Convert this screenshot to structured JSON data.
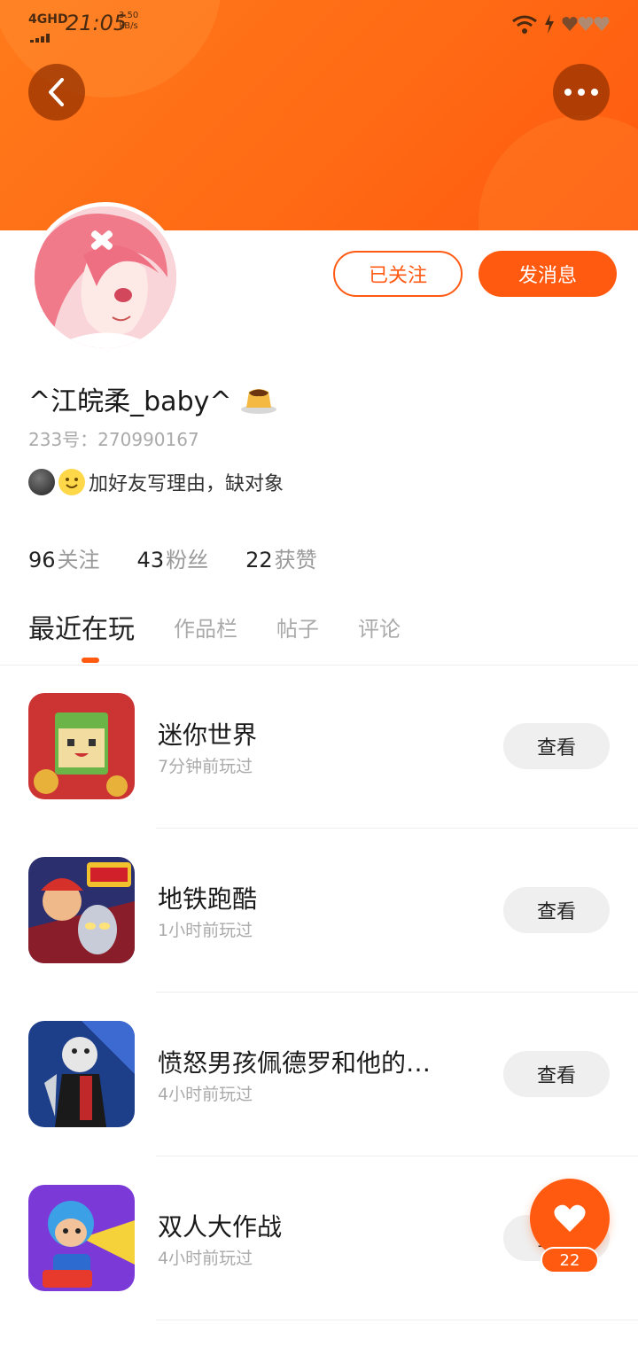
{
  "status_bar": {
    "network": "4GHD",
    "time": "21:05",
    "speed_value": "3.50",
    "speed_unit": "kB/s",
    "icons": [
      "wifi-icon",
      "charging-icon",
      "heart-battery-icon"
    ]
  },
  "header": {
    "back_icon": "chevron-left-icon",
    "more_icon": "more-dots-icon"
  },
  "profile": {
    "username": "^江皖柔_baby^",
    "uid": "233号：270990167",
    "bio": "加好友写理由，缺对象",
    "follow_button": "已关注",
    "message_button": "发消息"
  },
  "stats": [
    {
      "num": "96",
      "label": "关注"
    },
    {
      "num": "43",
      "label": "粉丝"
    },
    {
      "num": "22",
      "label": "获赞"
    }
  ],
  "tabs": [
    {
      "label": "最近在玩",
      "active": true
    },
    {
      "label": "作品栏",
      "active": false
    },
    {
      "label": "帖子",
      "active": false
    },
    {
      "label": "评论",
      "active": false
    }
  ],
  "games": [
    {
      "title": "迷你世界",
      "sub": "7分钟前玩过",
      "button": "查看"
    },
    {
      "title": "地铁跑酷",
      "sub": "1小时前玩过",
      "button": "查看"
    },
    {
      "title": "愤怒男孩佩德罗和他的…",
      "sub": "4小时前玩过",
      "button": "查看"
    },
    {
      "title": "双人大作战",
      "sub": "4小时前玩过",
      "button": "查看"
    }
  ],
  "like": {
    "count": "22"
  },
  "colors": {
    "accent": "#ff5a10",
    "header": "#ff7a1a"
  }
}
